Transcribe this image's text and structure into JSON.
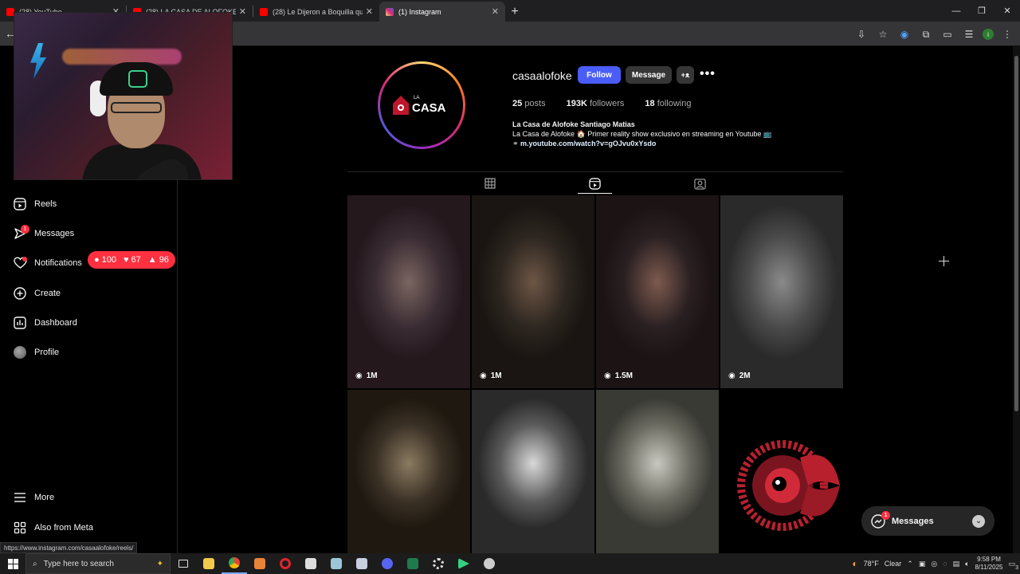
{
  "browser": {
    "tabs": [
      {
        "title": "(28) YouTube",
        "fav": "#ff0000",
        "active": false
      },
      {
        "title": "(28) LA CASA DE ALOFOKE",
        "fav": "#ff0000",
        "active": false
      },
      {
        "title": "(28) Le Dijeron a Boquilla que",
        "fav": "#ff0000",
        "active": false
      },
      {
        "title": "(1) Instagram",
        "fav": "#d62976",
        "active": true
      }
    ],
    "status_url": "https://www.instagram.com/casaalofoke/reels/"
  },
  "sidebar": {
    "items": [
      {
        "label": "Reels",
        "icon": "reels-icon"
      },
      {
        "label": "Messages",
        "icon": "messenger-icon",
        "badge": "1"
      },
      {
        "label": "Notifications",
        "icon": "heart-icon"
      },
      {
        "label": "Create",
        "icon": "plus-square-icon"
      },
      {
        "label": "Dashboard",
        "icon": "dashboard-icon"
      },
      {
        "label": "Profile",
        "icon": "avatar"
      }
    ],
    "bottom": [
      {
        "label": "More",
        "icon": "menu-icon"
      },
      {
        "label": "Also from Meta",
        "icon": "meta-icon"
      }
    ],
    "notif_pill": {
      "comments": "100",
      "likes": "67",
      "follows": "96"
    }
  },
  "profile": {
    "username": "casaalofoke",
    "follow_label": "Follow",
    "message_label": "Message",
    "posts_count": "25",
    "posts_label": "posts",
    "followers_count": "193K",
    "followers_label": "followers",
    "following_count": "18",
    "following_label": "following",
    "full_name": "La Casa de Alofoke Santiago Matias",
    "bio": "La Casa de Alofoke 🏠 Primer reality show exclusivo en streaming en Youtube 📺",
    "link": "m.youtube.com/watch?v=gOJvu0xYsdo",
    "logo_text": "CASA",
    "logo_small": "LA"
  },
  "reels": [
    {
      "views": "1M",
      "colors": [
        "#3a2c33",
        "#7a6560",
        "#24181d"
      ]
    },
    {
      "views": "1M",
      "colors": [
        "#2d2620",
        "#6d5645",
        "#1a1512"
      ]
    },
    {
      "views": "1.5M",
      "colors": [
        "#2a2022",
        "#7d5a4e",
        "#1c1314"
      ]
    },
    {
      "views": "2M",
      "colors": [
        "#4a4a4a",
        "#8a8a8a",
        "#2a2a2a"
      ]
    },
    {
      "views": "",
      "colors": [
        "#3a3025",
        "#8a7a60",
        "#1e1810"
      ]
    },
    {
      "views": "",
      "colors": [
        "#5a5a5a",
        "#d8d8d8",
        "#2a2a2a"
      ]
    },
    {
      "views": "",
      "colors": [
        "#6a6a60",
        "#c8c8c0",
        "#3a3a35"
      ]
    },
    {
      "views": "",
      "colors": [
        "#000000",
        "#000000",
        "#000000"
      ]
    }
  ],
  "messages_bar": {
    "label": "Messages",
    "badge": "1"
  },
  "taskbar": {
    "search_placeholder": "Type here to search",
    "weather": "78°F",
    "weather_desc": "Clear",
    "time": "9:58 PM",
    "date": "8/11/2025",
    "notif_count": "3"
  },
  "colors": {
    "accent": "#4a5df9",
    "badge": "#ff3040"
  }
}
